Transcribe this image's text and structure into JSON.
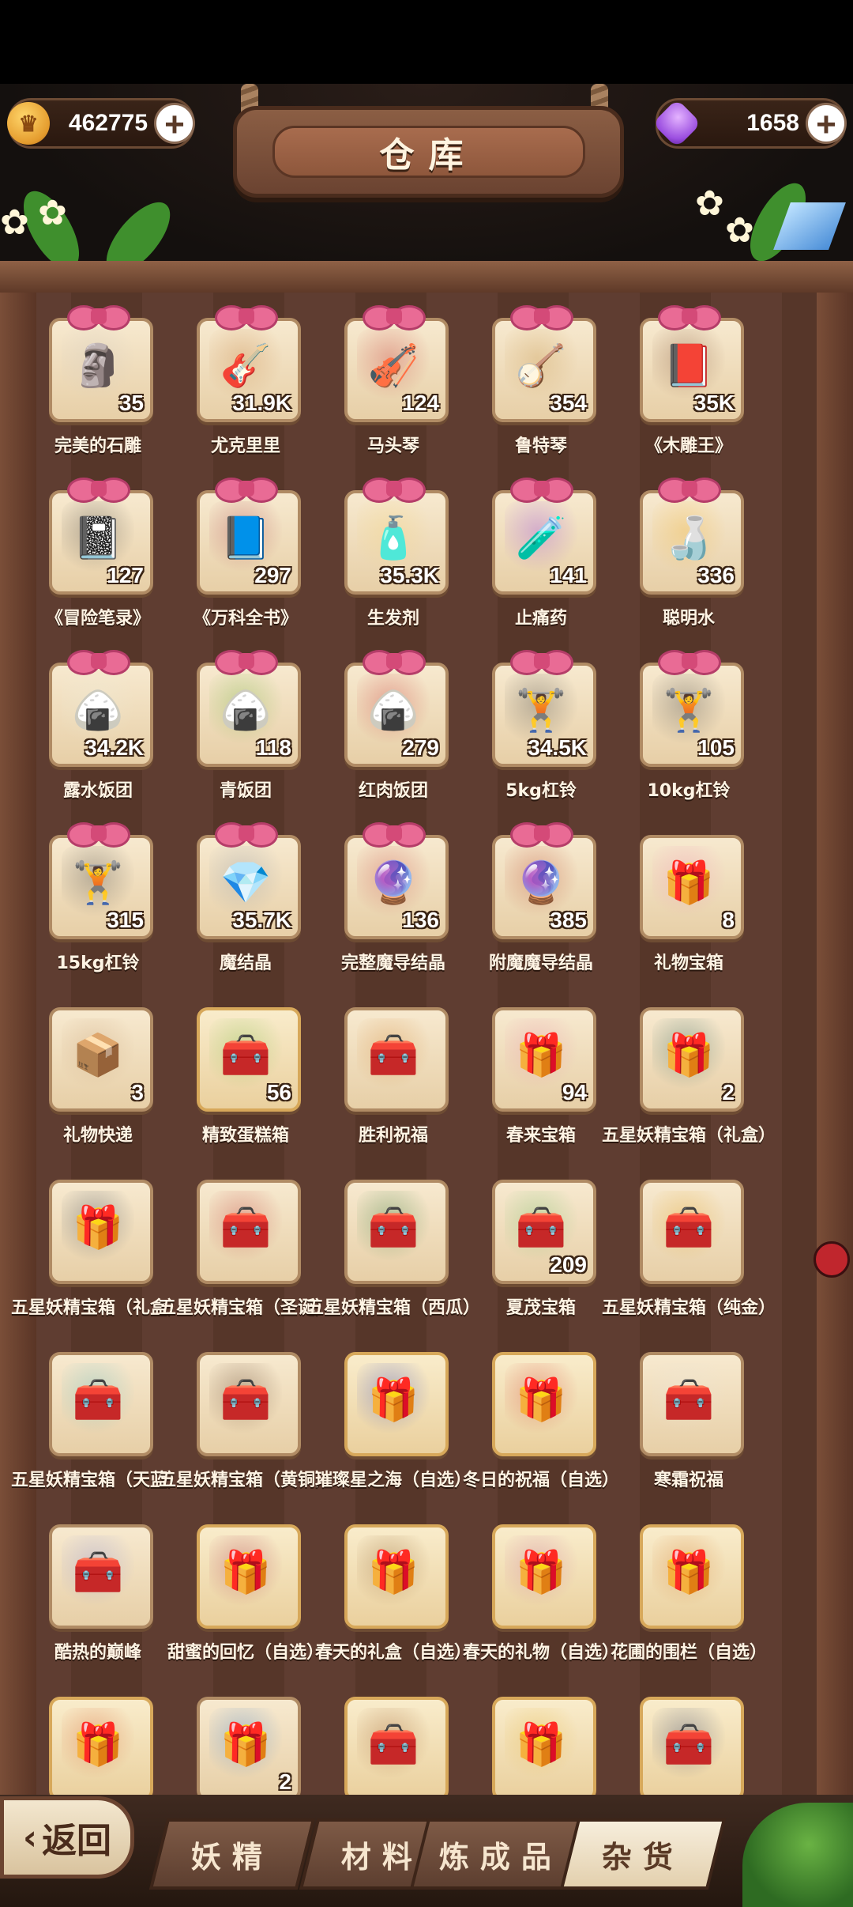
{
  "header": {
    "title": "仓库",
    "gold": {
      "value": "462775",
      "icon": "gold-crown-coin-icon"
    },
    "gems": {
      "value": "1658",
      "icon": "purple-gem-icon"
    },
    "plus": "+"
  },
  "items": [
    {
      "name": "完美的石雕",
      "count": "35",
      "icon": "statue-icon",
      "bow": true,
      "color": "#cfc6bd",
      "glyph": "🗿"
    },
    {
      "name": "尤克里里",
      "count": "31.9K",
      "icon": "ukulele-icon",
      "bow": true,
      "color": "#c98a4b",
      "glyph": "🎸"
    },
    {
      "name": "马头琴",
      "count": "124",
      "icon": "morin-khuur-icon",
      "bow": true,
      "color": "#c94040",
      "glyph": "🎻"
    },
    {
      "name": "鲁特琴",
      "count": "354",
      "icon": "lute-icon",
      "bow": true,
      "color": "#c99b52",
      "glyph": "🪕"
    },
    {
      "name": "《木雕王》",
      "count": "35K",
      "icon": "brown-book-icon",
      "bow": true,
      "color": "#7a4a30",
      "glyph": "📕"
    },
    {
      "name": "《冒险笔录》",
      "count": "127",
      "icon": "black-book-icon",
      "bow": true,
      "color": "#3a3a3a",
      "glyph": "📓"
    },
    {
      "name": "《万科全书》",
      "count": "297",
      "icon": "red-book-icon",
      "bow": true,
      "color": "#a83a4a",
      "glyph": "📘"
    },
    {
      "name": "生发剂",
      "count": "35.3K",
      "icon": "potion-bottle-icon",
      "bow": true,
      "color": "#f2d27a",
      "glyph": "🧴"
    },
    {
      "name": "止痛药",
      "count": "141",
      "icon": "purple-potion-icon",
      "bow": true,
      "color": "#9b4ee0",
      "glyph": "🧪"
    },
    {
      "name": "聪明水",
      "count": "336",
      "icon": "yellow-potion-icon",
      "bow": true,
      "color": "#f0b63a",
      "glyph": "🍶"
    },
    {
      "name": "露水饭团",
      "count": "34.2K",
      "icon": "rice-ball-icon",
      "bow": true,
      "color": "#ecebd8",
      "glyph": "🍙"
    },
    {
      "name": "青饭团",
      "count": "118",
      "icon": "green-rice-ball-icon",
      "bow": true,
      "color": "#6fb33d",
      "glyph": "🍙"
    },
    {
      "name": "红肉饭团",
      "count": "279",
      "icon": "meat-rice-ball-icon",
      "bow": true,
      "color": "#c9343a",
      "glyph": "🍙"
    },
    {
      "name": "5kg杠铃",
      "count": "34.5K",
      "icon": "dumbbell-icon",
      "bow": true,
      "color": "#4a4a4a",
      "glyph": "🏋"
    },
    {
      "name": "10kg杠铃",
      "count": "105",
      "icon": "dumbbell-icon",
      "bow": true,
      "color": "#4a4a4a",
      "glyph": "🏋"
    },
    {
      "name": "15kg杠铃",
      "count": "315",
      "icon": "dumbbell-icon",
      "bow": true,
      "color": "#4a4a4a",
      "glyph": "🏋"
    },
    {
      "name": "魔结晶",
      "count": "35.7K",
      "icon": "magic-crystal-icon",
      "bow": true,
      "color": "#8a97a8",
      "glyph": "💎"
    },
    {
      "name": "完整魔导结晶",
      "count": "136",
      "icon": "orb-crystal-icon",
      "bow": true,
      "color": "#c9494a",
      "glyph": "🔮"
    },
    {
      "name": "附魔魔导结晶",
      "count": "385",
      "icon": "enchanted-orb-icon",
      "bow": true,
      "color": "#b8402a",
      "glyph": "🔮"
    },
    {
      "name": "礼物宝箱",
      "count": "8",
      "icon": "pink-gift-chest-icon",
      "bow": false,
      "color": "#f08fb5",
      "glyph": "🎁"
    },
    {
      "name": "礼物快递",
      "count": "3",
      "icon": "parcel-icon",
      "bow": false,
      "color": "#c8a27a",
      "glyph": "📦"
    },
    {
      "name": "精致蛋糕箱",
      "count": "56",
      "icon": "cake-chest-icon",
      "bow": false,
      "gold": true,
      "color": "#7cbf4a",
      "glyph": "🧰"
    },
    {
      "name": "胜利祝福",
      "count": "",
      "icon": "victory-chest-icon",
      "bow": false,
      "color": "#d58a3a",
      "glyph": "🧰"
    },
    {
      "name": "春来宝箱",
      "count": "94",
      "icon": "spring-gift-box-icon",
      "bow": false,
      "color": "#e98aa6",
      "glyph": "🎁"
    },
    {
      "name": "五星妖精宝箱（礼盒）",
      "count": "2",
      "icon": "teal-gift-box-icon",
      "bow": false,
      "color": "#1f5c5a",
      "glyph": "🎁"
    },
    {
      "name": "五星妖精宝箱（礼盒）",
      "count": "",
      "icon": "navy-gift-box-icon",
      "bow": false,
      "color": "#2a3a52",
      "glyph": "🎁"
    },
    {
      "name": "五星妖精宝箱（圣诞）",
      "count": "",
      "icon": "christmas-chest-icon",
      "bow": false,
      "color": "#c03a3a",
      "glyph": "🧰"
    },
    {
      "name": "五星妖精宝箱（西瓜）",
      "count": "",
      "icon": "watermelon-chest-icon",
      "bow": false,
      "color": "#2e7a3a",
      "glyph": "🧰"
    },
    {
      "name": "夏茂宝箱",
      "count": "209",
      "icon": "green-chest-icon",
      "bow": false,
      "color": "#6fbf6a",
      "glyph": "🧰"
    },
    {
      "name": "五星妖精宝箱（纯金）",
      "count": "",
      "icon": "golden-chest-icon",
      "bow": false,
      "color": "#e4a72a",
      "glyph": "🧰"
    },
    {
      "name": "五星妖精宝箱（天蓝）",
      "count": "",
      "icon": "sky-blue-chest-icon",
      "bow": false,
      "color": "#5fbcc4",
      "glyph": "🧰"
    },
    {
      "name": "五星妖精宝箱（黄铜）",
      "count": "",
      "icon": "brass-chest-icon",
      "bow": false,
      "color": "#5a3a28",
      "glyph": "🧰"
    },
    {
      "name": "璀璨星之海（自选）",
      "count": "",
      "icon": "starry-gift-icon",
      "bow": false,
      "gold": true,
      "color": "#2a3fc0",
      "glyph": "🎁"
    },
    {
      "name": "冬日的祝福（自选）",
      "count": "",
      "icon": "winter-gift-icon",
      "bow": false,
      "gold": true,
      "color": "#d4382e",
      "glyph": "🎁"
    },
    {
      "name": "寒霜祝福",
      "count": "",
      "icon": "frost-chest-icon",
      "bow": false,
      "color": "#e8e2d4",
      "glyph": "🧰"
    },
    {
      "name": "酷热的巅峰",
      "count": "",
      "icon": "blue-chest-icon",
      "bow": false,
      "color": "#8a90d8",
      "glyph": "🧰"
    },
    {
      "name": "甜蜜的回忆（自选）",
      "count": "",
      "icon": "sweet-gift-icon",
      "bow": false,
      "gold": true,
      "color": "#a82a4a",
      "glyph": "🎁"
    },
    {
      "name": "春天的礼盒（自选）",
      "count": "",
      "icon": "brown-gift-box-icon",
      "bow": false,
      "gold": true,
      "color": "#8a5a2a",
      "glyph": "🎁"
    },
    {
      "name": "春天的礼物（自选）",
      "count": "",
      "icon": "pink-gift-box-icon",
      "bow": false,
      "gold": true,
      "color": "#c86a9a",
      "glyph": "🎁"
    },
    {
      "name": "花圃的围栏（自选）",
      "count": "",
      "icon": "garden-gift-icon",
      "bow": false,
      "gold": true,
      "color": "#d4782a",
      "glyph": "🎁"
    },
    {
      "name": "",
      "count": "",
      "icon": "rainbow-gift-icon",
      "bow": false,
      "gold": true,
      "color": "#d85a2a",
      "glyph": "🎁"
    },
    {
      "name": "",
      "count": "2",
      "icon": "blue-white-gift-icon",
      "bow": false,
      "color": "#3a7ac8",
      "glyph": "🎁"
    },
    {
      "name": "",
      "count": "",
      "icon": "wooden-chest-icon",
      "bow": false,
      "gold": true,
      "color": "#9a5a2a",
      "glyph": "🧰"
    },
    {
      "name": "",
      "count": "",
      "icon": "gold-gift-box-icon",
      "bow": false,
      "gold": true,
      "color": "#e4b33a",
      "glyph": "🎁"
    },
    {
      "name": "",
      "count": "",
      "icon": "dark-blue-chest-icon",
      "bow": false,
      "gold": true,
      "color": "#2a3a6a",
      "glyph": "🧰"
    }
  ],
  "nav": {
    "back": "返回",
    "back_icon": "chevron-left-icon",
    "tabs": [
      {
        "label": "妖精",
        "active": false
      },
      {
        "label": "材料",
        "active": false
      },
      {
        "label": "炼成品",
        "active": false
      },
      {
        "label": "杂货",
        "active": true
      }
    ]
  }
}
